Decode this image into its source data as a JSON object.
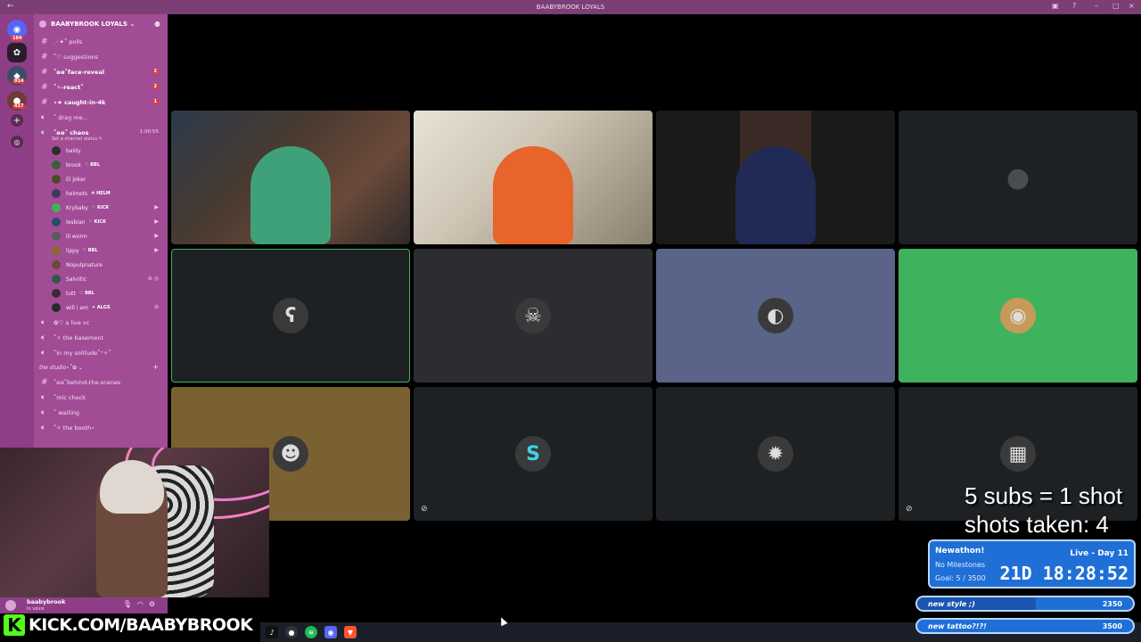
{
  "window": {
    "title": "BAABYBROOK LOYALS"
  },
  "rail": {
    "badges": [
      "184",
      "914",
      "417"
    ]
  },
  "server": {
    "name": "BAABYBROOK LOYALS ⌄"
  },
  "channels": [
    {
      "type": "text",
      "name": "⋰✦˚ polls",
      "count": ""
    },
    {
      "type": "text",
      "name": "˚♡ suggestions",
      "count": ""
    },
    {
      "type": "text",
      "name": "˚ʚɞ˚face-reveal",
      "count": "2"
    },
    {
      "type": "text",
      "name": "˚✧˖react˚",
      "count": "2"
    },
    {
      "type": "text",
      "name": "⋆★ caught-in-4k",
      "count": "1"
    },
    {
      "type": "voice",
      "name": "˚ drag me...",
      "count": ""
    }
  ],
  "active_voice": {
    "name": "˚ʚɞ˚ chaos",
    "time": "1:00:55",
    "status": "Set a channel status ✎",
    "members": [
      {
        "name": "baldy",
        "tag": "",
        "icon": ""
      },
      {
        "name": "brook",
        "tag": "♡ BBL",
        "icon": ""
      },
      {
        "name": "El Joker",
        "tag": "",
        "icon": ""
      },
      {
        "name": "helmets",
        "tag": "❄ HELM",
        "icon": ""
      },
      {
        "name": "Krybaby",
        "tag": "♡ KICK",
        "icon": "▶"
      },
      {
        "name": "lesbian",
        "tag": "♡ KICK",
        "icon": "▶"
      },
      {
        "name": "lil worm",
        "tag": "",
        "icon": "▶"
      },
      {
        "name": "lippy",
        "tag": "♡ BBL",
        "icon": "▶"
      },
      {
        "name": "Nopulpnature",
        "tag": "",
        "icon": ""
      },
      {
        "name": "Salviitic",
        "tag": "",
        "icon": "⊘ ◎"
      },
      {
        "name": "tutt",
        "tag": "♡ BBL",
        "icon": ""
      },
      {
        "name": "will i am",
        "tag": "✦ ALGS",
        "icon": "⊘"
      }
    ]
  },
  "voice_after": [
    {
      "name": "✿♡ a live vc"
    },
    {
      "name": "˚✧ the basement"
    },
    {
      "name": "˚in my solitude˚⁺✧˚"
    }
  ],
  "category": {
    "name": "the studio⋆˚✿ ⌄"
  },
  "studio_channels": [
    {
      "type": "text",
      "name": "˚ʚɞ˚behind-the-scenes"
    },
    {
      "type": "voice",
      "name": "˚mic check"
    },
    {
      "type": "voice",
      "name": "˚ waiting"
    },
    {
      "type": "voice",
      "name": "˚✧ the booth⋆"
    }
  ],
  "user": {
    "name": "baabybrook",
    "status": "In voice"
  },
  "kick": {
    "k": "K",
    "url": "KICK.COM/BAABYBROOK"
  },
  "overlay": {
    "subs_line1": "5 subs = 1 shot",
    "subs_line2": "shots taken: 4",
    "subathon_title": "Newathon!",
    "milestones": "No Milestones",
    "goal": "Goal: 5 / 3500",
    "live": "Live - Day 11",
    "timer": "21D 18:28:52",
    "goals": [
      {
        "label": "new style ;)",
        "value": "2350",
        "progress": 0.55
      },
      {
        "label": "new tattoo?!?!",
        "value": "3500",
        "progress": 0.0
      }
    ]
  },
  "tiles": [
    {
      "kind": "camera",
      "tone": "room-1"
    },
    {
      "kind": "camera",
      "tone": "room-2"
    },
    {
      "kind": "camera",
      "tone": "room-3"
    },
    {
      "kind": "avatar",
      "bg": "#1e2124",
      "icon": "person-icon"
    },
    {
      "kind": "avatar",
      "bg": "#1e2124",
      "icon": "bear-avatar"
    },
    {
      "kind": "avatar",
      "bg": "#2b2d31",
      "icon": "mask-avatar"
    },
    {
      "kind": "avatar",
      "bg": "#5a6489",
      "icon": "helmet-avatar"
    },
    {
      "kind": "avatar",
      "bg": "#3fb25d",
      "icon": "discord-avatar"
    },
    {
      "kind": "avatar",
      "bg": "#7a6132",
      "icon": "frog-avatar"
    },
    {
      "kind": "avatar",
      "bg": "#1e2124",
      "icon": "s-avatar"
    },
    {
      "kind": "avatar",
      "bg": "#1e2124",
      "icon": "dark-avatar"
    },
    {
      "kind": "avatar",
      "bg": "#1e2124",
      "icon": "car-avatar"
    }
  ]
}
